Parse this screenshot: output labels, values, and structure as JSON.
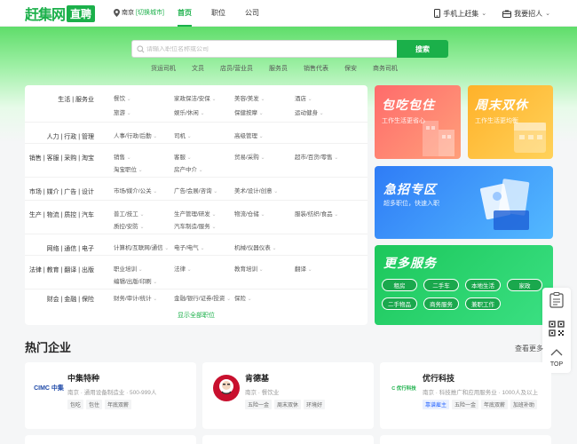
{
  "header": {
    "logo_text": "赶集网",
    "logo_badge": "直聘",
    "city": "南京",
    "city_switch": "[切换城市]",
    "nav": [
      "首页",
      "职位",
      "公司"
    ],
    "active_nav": "首页",
    "right": [
      "手机上赶集",
      "我要招人"
    ]
  },
  "search": {
    "placeholder": "请输入职位名称或公司",
    "button": "搜索",
    "hotwords": [
      "货运司机",
      "文员",
      "店员/营业员",
      "服务员",
      "销售代表",
      "保安",
      "商务司机"
    ]
  },
  "categories": [
    {
      "label": "生活 | 服务业",
      "items": [
        "餐饮",
        "家政保洁/安保",
        "美容/美发",
        "酒店",
        "旅游",
        "娱乐/休闲",
        "保健按摩",
        "运动健身"
      ]
    },
    {
      "label": "人力 | 行政 | 管理",
      "items": [
        "人事/行政/后勤",
        "司机",
        "高级管理"
      ]
    },
    {
      "label": "销售 | 客服 | 采购 | 淘宝",
      "items": [
        "销售",
        "客服",
        "贸易/采购",
        "超市/百货/零售",
        "淘宝职位",
        "房产中介"
      ]
    },
    {
      "label": "市场 | 媒介 | 广告 | 设计",
      "items": [
        "市场/媒介/公关",
        "广告/会展/咨询",
        "美术/设计/创意"
      ]
    },
    {
      "label": "生产 | 物流 | 质控 | 汽车",
      "items": [
        "普工/技工",
        "生产管理/研发",
        "物流/仓储",
        "服装/纺织/食品",
        "质控/安防",
        "汽车制造/服务"
      ]
    },
    {
      "label": "网络 | 通信 | 电子",
      "items": [
        "计算机/互联网/通信",
        "电子/电气",
        "机械/仪器仪表"
      ]
    },
    {
      "label": "法律 | 教育 | 翻译 | 出版",
      "items": [
        "职业培训",
        "法律",
        "教育培训",
        "翻译",
        "编辑/出版/印刷"
      ]
    },
    {
      "label": "财会 | 金融 | 保险",
      "items": [
        "财务/审计/统计",
        "金融/银行/证券/投资",
        "保险"
      ]
    }
  ],
  "show_all": "显示全部职位",
  "banners": {
    "b1_title": "包吃包住",
    "b1_sub": "工作生活更省心",
    "b2_title": "周末双休",
    "b2_sub": "工作生活更均衡",
    "b3_title": "急招专区",
    "b3_sub": "超多职位，快速入职",
    "b4_title": "更多服务",
    "services": [
      "租房",
      "二手车",
      "本地生活",
      "家政",
      "二手物品",
      "商务服务",
      "兼职工作"
    ]
  },
  "side_tools": {
    "top_label": "TOP"
  },
  "hot_companies": {
    "title": "热门企业",
    "view_more": "查看更多",
    "list": [
      {
        "name": "中集特种",
        "logo": "CIMC 中集",
        "meta": "南京 · 通用设备制造业 · 500-999人",
        "tags": [
          "包吃",
          "包住",
          "年底双薪"
        ]
      },
      {
        "name": "肯德基",
        "logo": "KFC",
        "meta": "南京 · 餐饮业",
        "tags": [
          "五险一金",
          "周末双休",
          "环境好"
        ]
      },
      {
        "name": "优行科技",
        "logo": "C 优行科技",
        "meta": "南京 · 科技推广和应用服务业 · 1000人及以上",
        "tags": [
          "靠谱雇主",
          "五险一金",
          "年底双薪",
          "加班补助"
        ]
      }
    ]
  },
  "colors": {
    "brand": "#1bb04a"
  }
}
